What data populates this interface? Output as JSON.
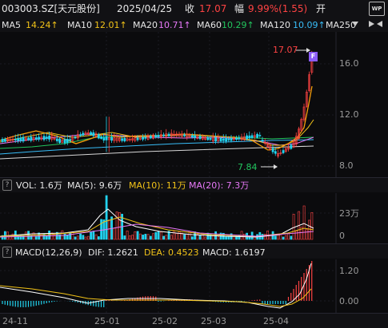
{
  "header": {
    "code": "003003.SZ[天元股份]",
    "date": "2025/04/25",
    "close_label": "收",
    "close_value": "17.07",
    "change_label": "幅",
    "change_value": "9.99%(1.55)",
    "open_label": "开"
  },
  "ma_legend": [
    {
      "label": "MA5",
      "value": "14.24↑",
      "color": "#f2c318"
    },
    {
      "label": "MA10",
      "value": "12.01↑",
      "color": "#f2c318"
    },
    {
      "label": "MA20",
      "value": "10.71↑",
      "color": "#e879f9"
    },
    {
      "label": "MA60",
      "value": "10.29↑",
      "color": "#22c55e"
    },
    {
      "label": "MA120",
      "value": "10.09↑",
      "color": "#38bdf8"
    },
    {
      "label": "MA250",
      "value": "",
      "color": "#cfcfcf"
    }
  ],
  "price_axis": {
    "ticks": [
      "16.0",
      "12.0",
      "8.0"
    ]
  },
  "annotations": {
    "high": "17.07",
    "low": "7.84",
    "badge": "F"
  },
  "volume_legend": {
    "vol_label": "VOL: 1.6万",
    "ma5_label": "MA(5): 9.6万",
    "ma10_label": "MA(10): 11万",
    "ma20_label": "MA(20): 7.3万"
  },
  "volume_axis": {
    "ticks": [
      "23万",
      "0"
    ]
  },
  "macd_legend": {
    "title": "MACD(12,26,9)",
    "dif": "DIF: 1.2621",
    "dea": "DEA: 0.4523",
    "macd": "MACD: 1.6197"
  },
  "macd_axis": {
    "ticks": [
      "1.20",
      "0.00"
    ]
  },
  "x_axis": {
    "ticks": [
      "24-11",
      "25-01",
      "25-02",
      "25-03",
      "25-04"
    ]
  },
  "icons": {
    "wp": "WP"
  },
  "colors": {
    "up": "#ff4343",
    "down": "#22d3ee",
    "bg": "#0b0b0d"
  }
}
